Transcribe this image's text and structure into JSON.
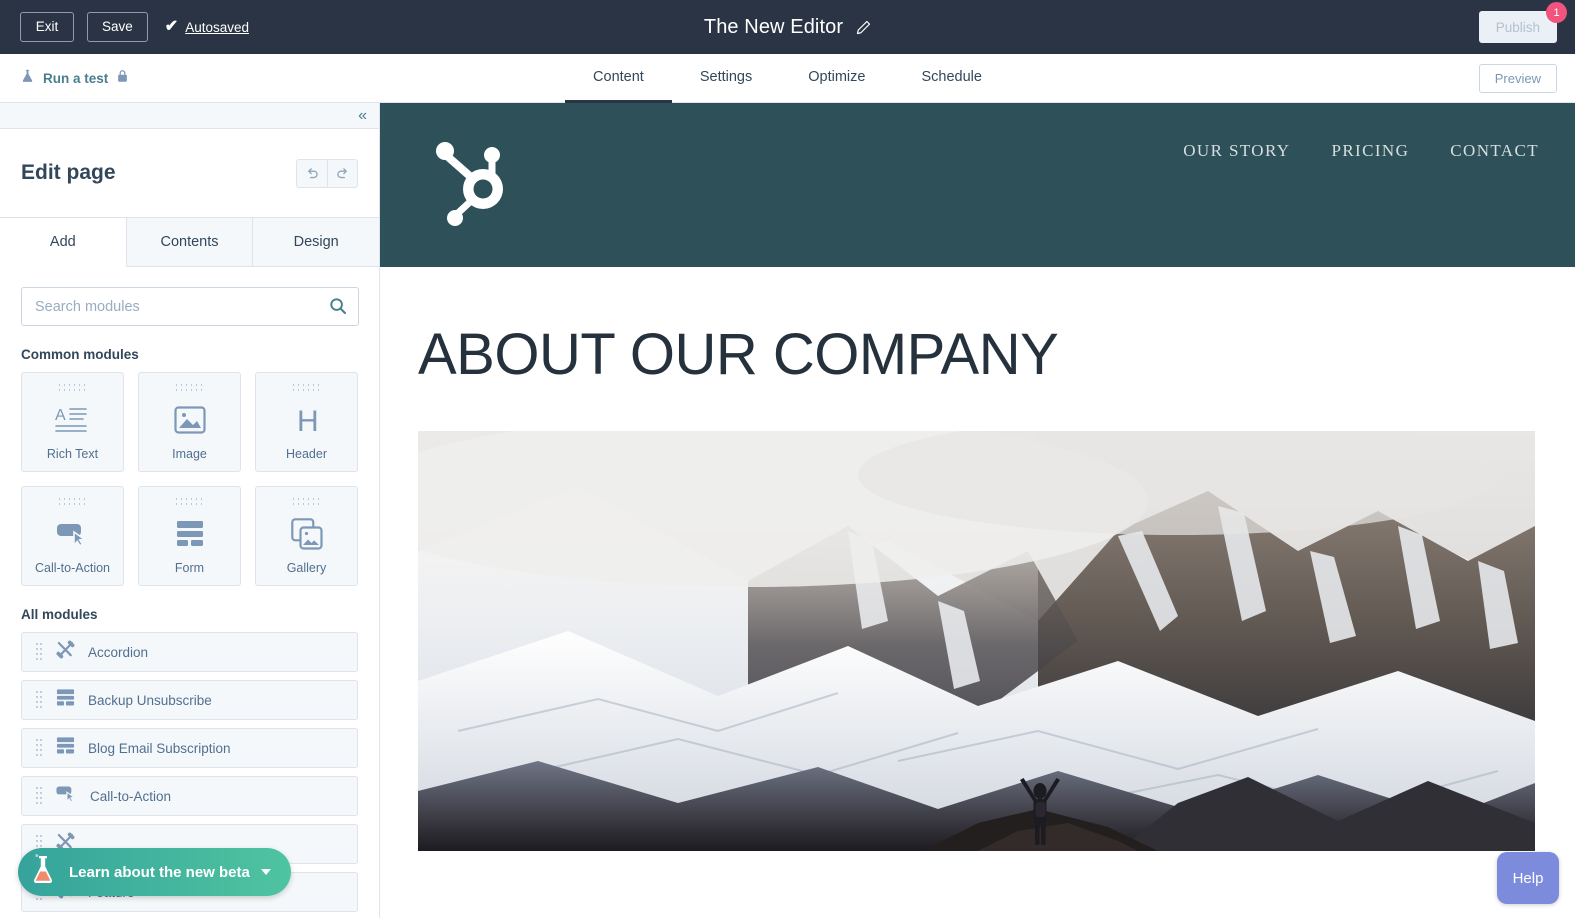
{
  "topbar": {
    "exit_label": "Exit",
    "save_label": "Save",
    "autosaved_label": "Autosaved",
    "check_glyph": "✔",
    "page_title": "The New Editor",
    "publish_label": "Publish",
    "publish_badge_count": "1",
    "colors": {
      "background": "#2b3445",
      "badge": "#f2547d",
      "publish_bg": "#eaf0f6"
    }
  },
  "navbar": {
    "run_test_label": "Run a test",
    "tabs": [
      {
        "label": "Content",
        "active": true
      },
      {
        "label": "Settings",
        "active": false
      },
      {
        "label": "Optimize",
        "active": false
      },
      {
        "label": "Schedule",
        "active": false
      }
    ],
    "preview_label": "Preview",
    "accent": "#4a7e8f"
  },
  "sidebar": {
    "collapse_glyph": "«",
    "title": "Edit page",
    "tabs": [
      {
        "label": "Add",
        "active": true
      },
      {
        "label": "Contents",
        "active": false
      },
      {
        "label": "Design",
        "active": false
      }
    ],
    "search": {
      "value": "",
      "placeholder": "Search modules"
    },
    "common_modules_label": "Common modules",
    "common_modules": [
      {
        "label": "Rich Text",
        "icon": "rich-text-icon"
      },
      {
        "label": "Image",
        "icon": "image-icon"
      },
      {
        "label": "Header",
        "icon": "header-icon"
      },
      {
        "label": "Call-to-Action",
        "icon": "cta-icon"
      },
      {
        "label": "Form",
        "icon": "form-icon"
      },
      {
        "label": "Gallery",
        "icon": "gallery-icon"
      }
    ],
    "all_modules_label": "All modules",
    "all_modules": [
      {
        "label": "Accordion",
        "icon": "custom-module-icon"
      },
      {
        "label": "Backup Unsubscribe",
        "icon": "form-icon"
      },
      {
        "label": "Blog Email Subscription",
        "icon": "form-icon"
      },
      {
        "label": "Call-to-Action",
        "icon": "cta-icon"
      },
      {
        "label": "",
        "icon": "custom-module-icon"
      },
      {
        "label": "Feature",
        "icon": "custom-module-icon"
      }
    ]
  },
  "beta_banner": {
    "label": "Learn about the new beta",
    "icon": "flask-icon",
    "gradient_start": "#35a39b",
    "gradient_end": "#4fc4a0"
  },
  "preview": {
    "site": {
      "logo": "hubspot-sprocket-logo",
      "header_bg": "#2e5059",
      "nav": [
        {
          "label": "OUR STORY"
        },
        {
          "label": "PRICING"
        },
        {
          "label": "CONTACT"
        }
      ],
      "heading": "ABOUT OUR COMPANY",
      "hero_image_alt": "snow-covered mountain range with a hiker raising both arms on a rocky outcrop"
    }
  },
  "help": {
    "label": "Help",
    "color": "#7c8bdc"
  }
}
